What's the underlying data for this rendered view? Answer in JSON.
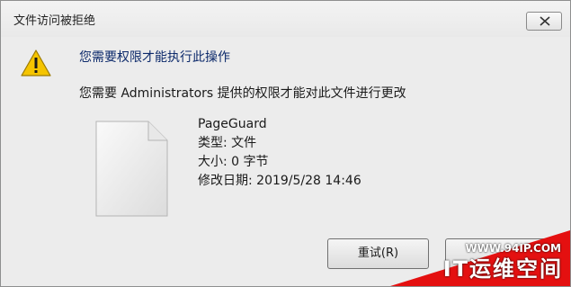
{
  "window": {
    "title": "文件访问被拒绝"
  },
  "dialog": {
    "heading": "您需要权限才能执行此操作",
    "message": "您需要 Administrators 提供的权限才能对此文件进行更改"
  },
  "file": {
    "name": "PageGuard",
    "type_label": "类型: 文件",
    "size_label": "大小: 0 字节",
    "modified_label": "修改日期: 2019/5/28 14:46"
  },
  "buttons": {
    "retry": "重试(R)",
    "cancel": ""
  },
  "watermark": {
    "url": "WWW.94IP.COM",
    "brand": "IT运维空间"
  },
  "icons": {
    "warning": "warning-icon",
    "file": "file-icon",
    "close": "close-icon"
  },
  "colors": {
    "heading": "#0d2a6b",
    "warning_fill": "#f5c400",
    "watermark_red": "#e41010"
  }
}
